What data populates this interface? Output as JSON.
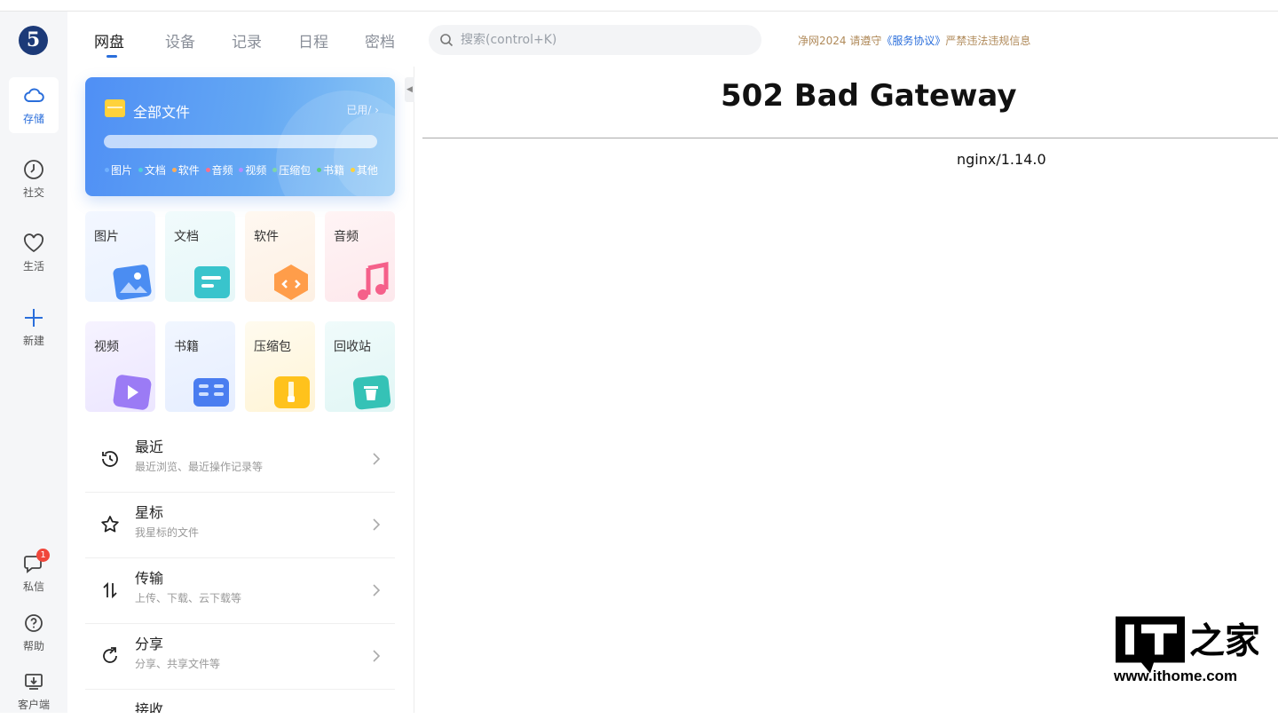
{
  "rail": {
    "logo": "5",
    "items": [
      {
        "label": "存储",
        "icon": "cloud-icon"
      },
      {
        "label": "社交",
        "icon": "clock-icon"
      },
      {
        "label": "生活",
        "icon": "heart-icon"
      },
      {
        "label": "新建",
        "icon": "plus-icon"
      }
    ],
    "bottom": [
      {
        "label": "私信",
        "icon": "chat-icon",
        "badge": "1"
      },
      {
        "label": "帮助",
        "icon": "help-icon"
      },
      {
        "label": "客户端",
        "icon": "download-icon"
      }
    ]
  },
  "header": {
    "tabs": [
      "网盘",
      "设备",
      "记录",
      "日程",
      "密档"
    ],
    "active_tab": "网盘",
    "search_placeholder": "搜索(control+K)",
    "notice_prefix": "净网2024 请遵守",
    "notice_link": "《服务协议》",
    "notice_suffix": "严禁违法违规信息"
  },
  "all_files": {
    "title": "全部文件",
    "used": "已用/",
    "legend": [
      {
        "label": "图片",
        "color": "#6fb0ff"
      },
      {
        "label": "文档",
        "color": "#4fd1d9"
      },
      {
        "label": "软件",
        "color": "#ffae57"
      },
      {
        "label": "音频",
        "color": "#ff6f8a"
      },
      {
        "label": "视频",
        "color": "#b48cff"
      },
      {
        "label": "压缩包",
        "color": "#7fd6a8"
      },
      {
        "label": "书籍",
        "color": "#5ad07a"
      },
      {
        "label": "其他",
        "color": "#ffd23b"
      }
    ]
  },
  "categories": [
    {
      "label": "图片",
      "icon": "image-icon"
    },
    {
      "label": "文档",
      "icon": "document-icon"
    },
    {
      "label": "软件",
      "icon": "software-icon"
    },
    {
      "label": "音频",
      "icon": "music-icon"
    },
    {
      "label": "视频",
      "icon": "video-icon"
    },
    {
      "label": "书籍",
      "icon": "book-icon"
    },
    {
      "label": "压缩包",
      "icon": "zip-icon"
    },
    {
      "label": "回收站",
      "icon": "trash-icon"
    }
  ],
  "rows": [
    {
      "title": "最近",
      "subtitle": "最近浏览、最近操作记录等",
      "icon": "history-icon"
    },
    {
      "title": "星标",
      "subtitle": "我星标的文件",
      "icon": "star-icon"
    },
    {
      "title": "传输",
      "subtitle": "上传、下载、云下载等",
      "icon": "transfer-icon"
    },
    {
      "title": "分享",
      "subtitle": "分享、共享文件等",
      "icon": "share-icon"
    },
    {
      "title": "接收",
      "subtitle": "",
      "icon": "receive-icon"
    }
  ],
  "error": {
    "title": "502 Bad Gateway",
    "server": "nginx/1.14.0"
  },
  "watermark": {
    "logo": "IT之家",
    "url": "www.ithome.com"
  }
}
